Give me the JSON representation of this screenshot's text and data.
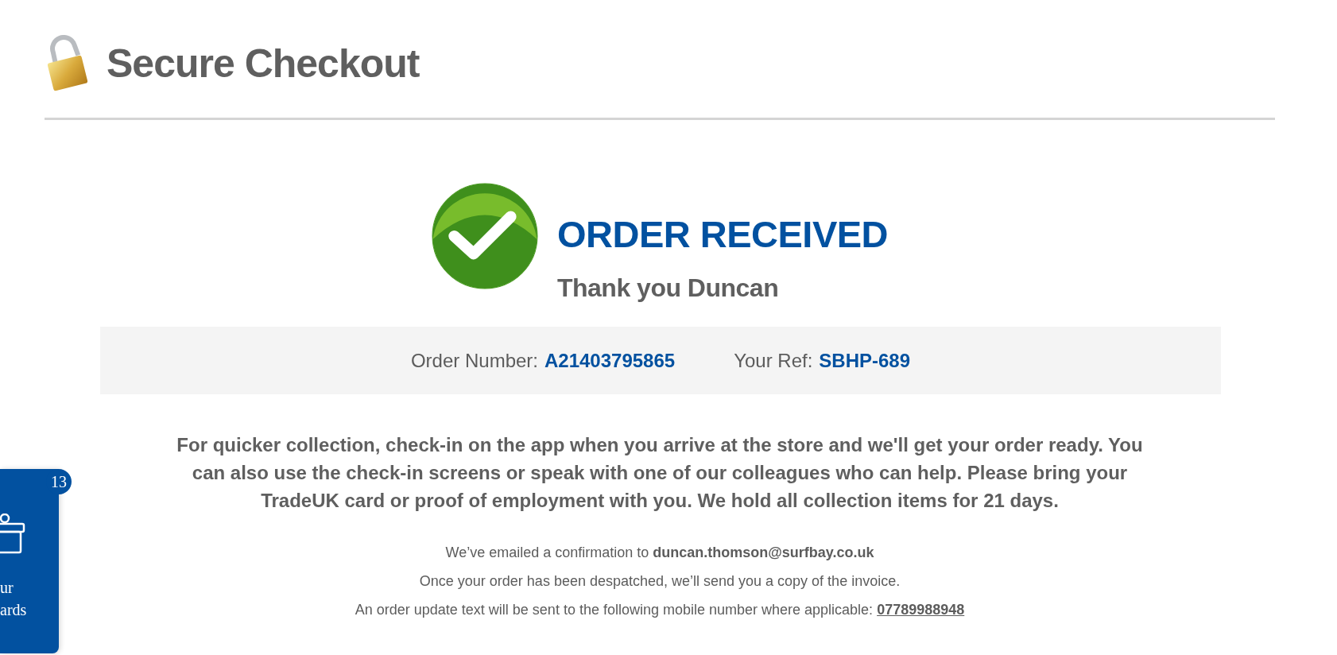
{
  "header": {
    "title": "Secure Checkout"
  },
  "confirmation": {
    "heading": "ORDER RECEIVED",
    "greeting": "Thank you Duncan"
  },
  "order_info": [
    {
      "label": "Order Number:",
      "value": "A21403795865"
    },
    {
      "label": "Your Ref:",
      "value": "SBHP-689"
    }
  ],
  "collection_message": "For quicker collection, check-in on the app when you arrive at the store and we'll get your order ready. You can also use the check-in screens or speak with one of our colleagues who can help. Please bring your TradeUK card or proof of employment with you. We hold all collection items for 21 days.",
  "notices": [
    {
      "kind": "text",
      "text": "We’ve emailed a confirmation to **duncan.thomson@surfbay.co.uk**"
    },
    {
      "kind": "text",
      "text": "Once your order has been despatched, we’ll send you a copy of the invoice."
    },
    {
      "kind": "link",
      "text": "An order update text will be sent to the following mobile number where applicable: ",
      "link": "07789988948"
    }
  ],
  "rewards_widget": {
    "badge": "13",
    "label_lines": [
      "ur",
      "ards"
    ]
  }
}
